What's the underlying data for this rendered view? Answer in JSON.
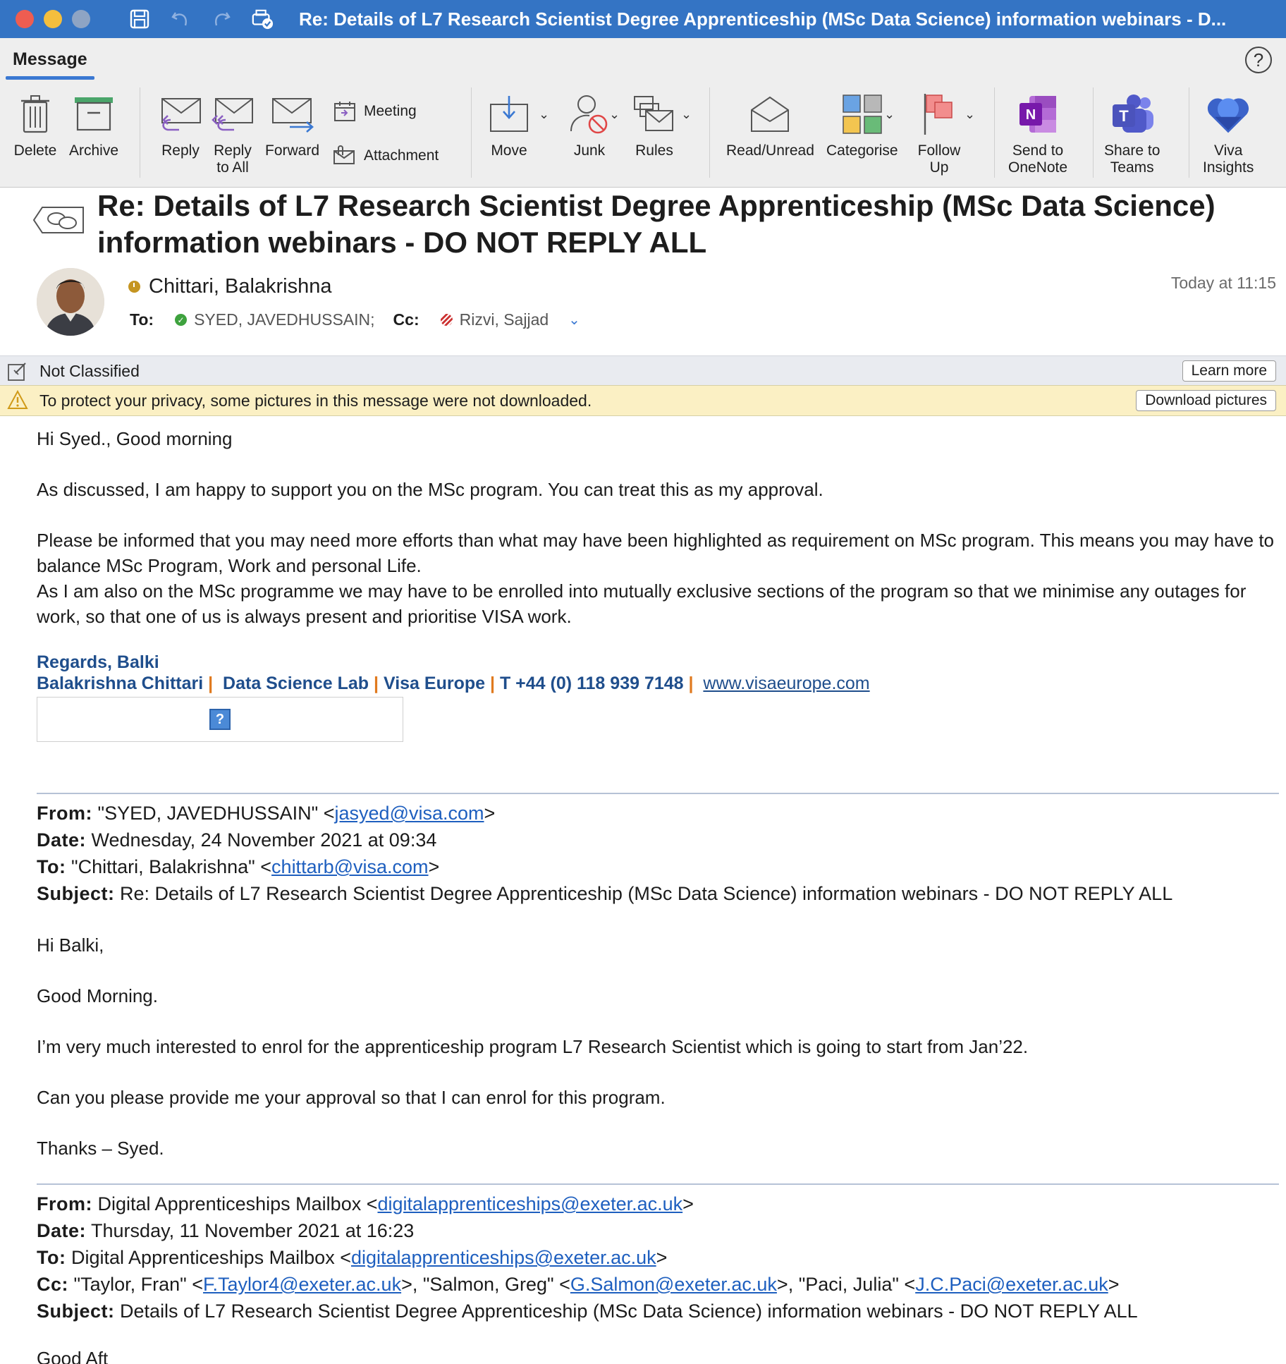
{
  "window": {
    "title": "Re: Details of L7 Research Scientist Degree Apprenticeship (MSc Data Science) information webinars - D..."
  },
  "ribbon": {
    "tab": "Message",
    "help": "?",
    "buttons": {
      "delete": "Delete",
      "archive": "Archive",
      "reply": "Reply",
      "reply_all_1": "Reply",
      "reply_all_2": "to All",
      "forward": "Forward",
      "meeting": "Meeting",
      "attachment": "Attachment",
      "move": "Move",
      "junk": "Junk",
      "rules": "Rules",
      "read_unread": "Read/Unread",
      "categorise": "Categorise",
      "follow_up_1": "Follow",
      "follow_up_2": "Up",
      "onenote_1": "Send to",
      "onenote_2": "OneNote",
      "teams_1": "Share to",
      "teams_2": "Teams",
      "viva_1": "Viva",
      "viva_2": "Insights"
    }
  },
  "message": {
    "subject_line1": "Re: Details of L7 Research Scientist Degree Apprenticeship (MSc Data Science)",
    "subject_line2": "information webinars - DO NOT REPLY ALL",
    "sender": "Chittari, Balakrishna",
    "time": "Today at 11:15",
    "to_label": "To:",
    "to": "SYED, JAVEDHUSSAIN;",
    "cc_label": "Cc:",
    "cc": "Rizvi, Sajjad"
  },
  "bars": {
    "classification": "Not Classified",
    "learn_more": "Learn more",
    "privacy": "To protect your privacy, some pictures in this message were not downloaded.",
    "download": "Download pictures"
  },
  "body": {
    "greeting": "Hi Syed., Good morning",
    "p1": "As discussed, I am happy to support you on the MSc program. You can treat this as my approval.",
    "p2": "Please be informed that you may need more efforts than what may have been highlighted as requirement on MSc program. This means you may have to balance MSc Program, Work and personal Life.",
    "p3": "As I am also on the MSc programme we may have to be enrolled into mutually exclusive sections of the program so that we minimise any outages for work, so that one of us is always present and prioritise VISA work.",
    "sig_regards": "Regards, Balki",
    "sig_name": "Balakrishna Chittari",
    "sig_sep": "|",
    "sig_lab": "Data Science Lab",
    "sig_company": "Visa Europe",
    "sig_phone": "T +44 (0) 118 939 7148",
    "sig_web": "www.visaeurope.com",
    "sig_img": "?"
  },
  "quote1": {
    "from_label": "From:",
    "from_name": "\"SYED, JAVEDHUSSAIN\" <",
    "from_email": "jasyed@visa.com",
    "from_end": ">",
    "date_label": "Date:",
    "date": "Wednesday, 24 November 2021 at 09:34",
    "to_label": "To:",
    "to_name": "\"Chittari, Balakrishna\" <",
    "to_email": "chittarb@visa.com",
    "to_end": ">",
    "subject_label": "Subject:",
    "subject": "Re: Details of L7 Research Scientist Degree Apprenticeship (MSc Data Science) information webinars - DO NOT REPLY ALL",
    "l1": "Hi Balki,",
    "l2": "Good Morning.",
    "l3": "I’m very much interested to enrol for the apprenticeship program L7 Research Scientist which is going to start from Jan’22.",
    "l4": "Can you please provide me your approval so that I can enrol for this program.",
    "l5": "Thanks – Syed."
  },
  "quote2": {
    "from_label": "From:",
    "from_name": "Digital Apprenticeships Mailbox <",
    "from_email": "digitalapprenticeships@exeter.ac.uk",
    "from_end": ">",
    "date_label": "Date:",
    "date": "Thursday, 11 November 2021 at 16:23",
    "to_label": "To:",
    "to_name": "Digital Apprenticeships Mailbox <",
    "to_email": "digitalapprenticeships@exeter.ac.uk",
    "to_end": ">",
    "cc_label": "Cc:",
    "cc1_name": "\"Taylor, Fran\" <",
    "cc1_email": "F.Taylor4@exeter.ac.uk",
    "cc2_name": ">, \"Salmon, Greg\" <",
    "cc2_email": "G.Salmon@exeter.ac.uk",
    "cc3_name": ">, \"Paci, Julia\" <",
    "cc3_email": "J.C.Paci@exeter.ac.uk",
    "cc_end": ">",
    "subject_label": "Subject:",
    "subject": "Details of L7 Research Scientist Degree Apprenticeship (MSc Data Science) information webinars - DO NOT REPLY ALL",
    "next_line": "Good Aft"
  },
  "colors": {
    "titlebar": "#3474c4",
    "accent": "#3a78d2",
    "signature": "#1f4e8c",
    "signature_separator": "#e07a1f",
    "link": "#1e5fbf"
  }
}
